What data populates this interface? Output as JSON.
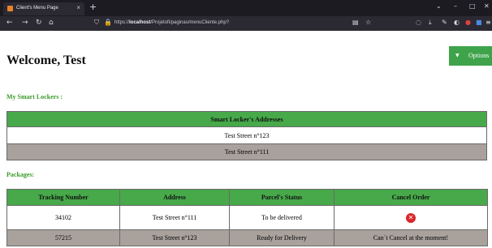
{
  "browser": {
    "tab_title": "Client's Menu Page",
    "tab_close": "×",
    "new_tab": "+",
    "url_prefix": "https://",
    "url_host": "localhost",
    "url_path": "/Projetofi/paginas/menuCliente.php?"
  },
  "page": {
    "welcome": "Welcome, Test",
    "options_label": "Options",
    "lockers_title": "My Smart Lockers :",
    "packages_title": "Packages:"
  },
  "lockers": {
    "header": "Smart Locker's Addresses",
    "rows": [
      "Test Street n°123",
      "Test Street n°111"
    ]
  },
  "packages": {
    "headers": [
      "Tracking Number",
      "Address",
      "Parcel's Status",
      "Cancel Order"
    ],
    "rows": [
      {
        "tracking": "34102",
        "address": "Test Street n°111",
        "status": "To be delivered",
        "cancel": ""
      },
      {
        "tracking": "57215",
        "address": "Test Street n°123",
        "status": "Ready for Delivery",
        "cancel": "Can´t Cancel at the moment!"
      }
    ]
  },
  "icons": {
    "cancel": "cancel-x-icon"
  },
  "colors": {
    "accent_green": "#47a94a",
    "title_green": "#3a9a2a",
    "alt_row": "#a8a19c",
    "cancel_red": "#d9262b"
  }
}
